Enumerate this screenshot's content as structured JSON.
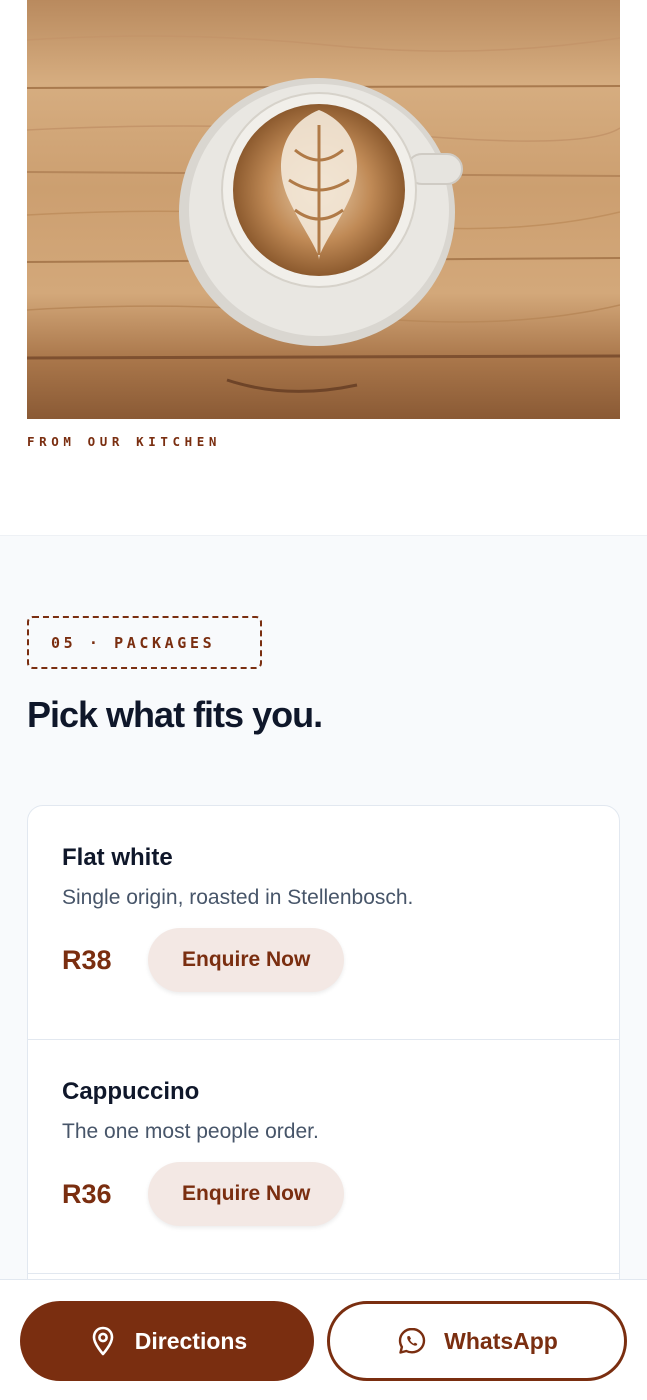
{
  "hero": {
    "image_icon": "latte-art-coffee-photo",
    "caption": "FROM OUR KITCHEN"
  },
  "packages": {
    "eyebrow": "05 · PACKAGES",
    "heading": "Pick what fits you.",
    "items": [
      {
        "name": "Flat white",
        "description": "Single origin, roasted in Stellenbosch.",
        "price": "R38",
        "cta": "Enquire Now"
      },
      {
        "name": "Cappuccino",
        "description": "The one most people order.",
        "price": "R36",
        "cta": "Enquire Now"
      }
    ]
  },
  "action_bar": {
    "directions_label": "Directions",
    "directions_icon": "map-pin-icon",
    "whatsapp_label": "WhatsApp",
    "whatsapp_icon": "whatsapp-icon"
  },
  "colors": {
    "accent": "#7a2e10",
    "accent_soft": "#f3e8e4",
    "text_dark": "#0f172a",
    "text_muted": "#475569",
    "section_bg": "#f8fafc"
  }
}
